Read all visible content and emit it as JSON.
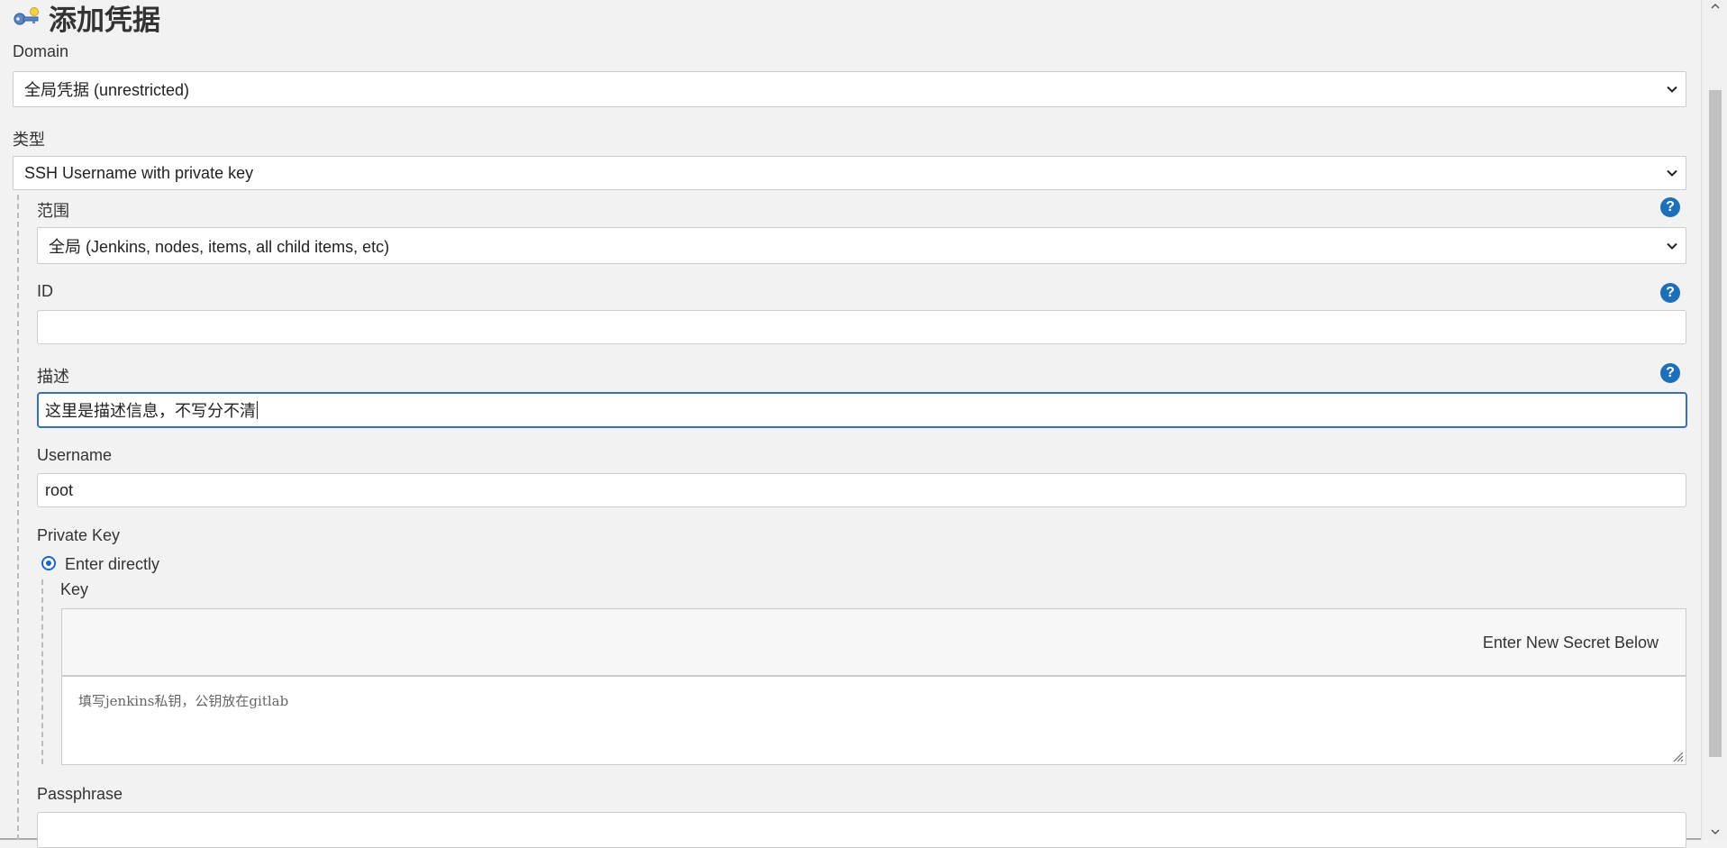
{
  "header": {
    "title": "添加凭据",
    "icon": "key-icon"
  },
  "domain": {
    "label": "Domain",
    "value": "全局凭据 (unrestricted)"
  },
  "type": {
    "label": "类型",
    "value": "SSH Username with private key"
  },
  "scope": {
    "label": "范围",
    "value": "全局 (Jenkins, nodes, items, all child items, etc)"
  },
  "id": {
    "label": "ID",
    "value": ""
  },
  "description": {
    "label": "描述",
    "value": "这里是描述信息，不写分不清"
  },
  "username": {
    "label": "Username",
    "value": "root"
  },
  "private_key": {
    "label": "Private Key",
    "option_label": "Enter directly",
    "key_label": "Key",
    "secret_header": "Enter New Secret Below",
    "placeholder": "填写jenkins私钥，公钥放在gitlab"
  },
  "passphrase": {
    "label": "Passphrase",
    "value": ""
  },
  "help": {
    "symbol": "?"
  },
  "colors": {
    "accent": "#1d6fb8",
    "focus": "#3a6fb3",
    "background": "#f2f2f2"
  }
}
